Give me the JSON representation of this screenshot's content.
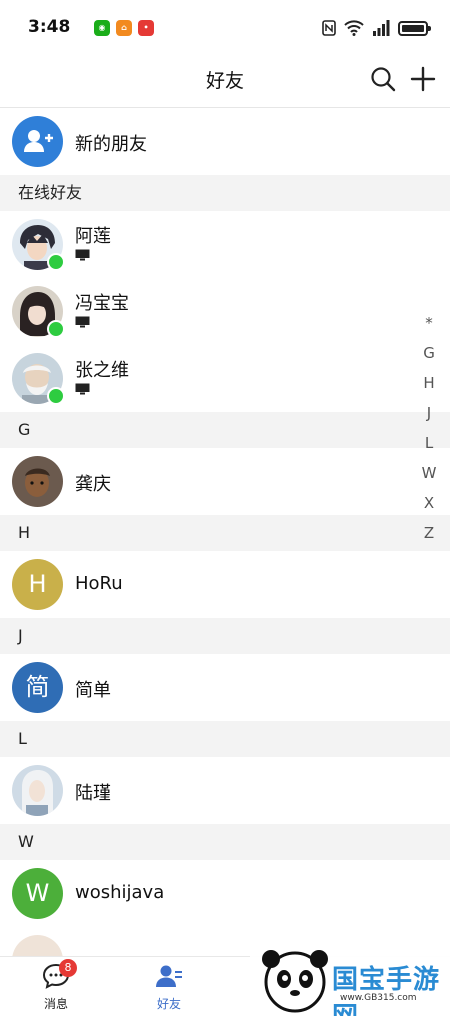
{
  "status_bar": {
    "time": "3:48"
  },
  "header": {
    "title": "好友"
  },
  "new_friends": {
    "label": "新的朋友"
  },
  "online_section": {
    "title": "在线好友",
    "items": [
      {
        "name": "阿莲"
      },
      {
        "name": "冯宝宝"
      },
      {
        "name": "张之维"
      }
    ]
  },
  "sections": [
    {
      "letter": "G",
      "items": [
        {
          "name": "龚庆"
        }
      ]
    },
    {
      "letter": "H",
      "items": [
        {
          "name": "HoRu",
          "avatar_letter": "H",
          "avatar_color": "#c9b04a"
        }
      ]
    },
    {
      "letter": "J",
      "items": [
        {
          "name": "简单",
          "avatar_letter": "简",
          "avatar_color": "#2f6db5"
        }
      ]
    },
    {
      "letter": "L",
      "items": [
        {
          "name": "陆瑾"
        }
      ]
    },
    {
      "letter": "W",
      "items": [
        {
          "name": "woshijava",
          "avatar_letter": "W",
          "avatar_color": "#4caf3a"
        }
      ]
    }
  ],
  "alphabet_index": [
    "*",
    "G",
    "H",
    "J",
    "L",
    "W",
    "X",
    "Z"
  ],
  "tab_bar": {
    "messages": {
      "label": "消息",
      "badge": "8"
    },
    "friends": {
      "label": "好友"
    }
  },
  "watermark": {
    "brand": "国宝手游网",
    "url": "www.GB315.com"
  },
  "colors": {
    "online": "#2ecc40",
    "badge": "#e53935",
    "accent_tab": "#3d6ec9",
    "new_friend_avatar": "#2f7fd8"
  }
}
